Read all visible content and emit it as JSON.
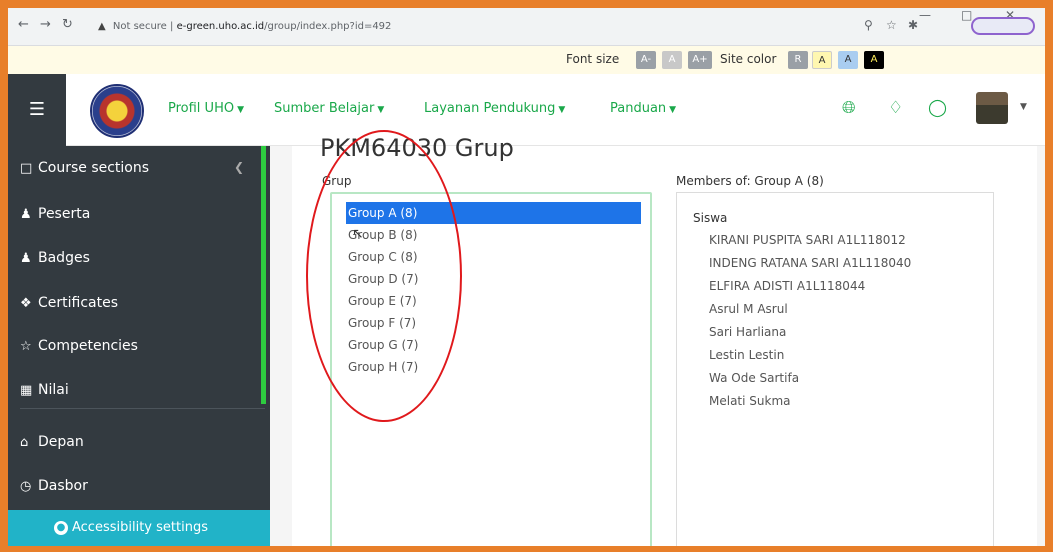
{
  "browser": {
    "security_label": "Not secure",
    "url_host": "e-green.uho.ac.id",
    "url_path": "/group/index.php?id=492"
  },
  "access_bar": {
    "font_size_label": "Font size",
    "font_buttons": [
      "A-",
      "A",
      "A+"
    ],
    "site_color_label": "Site color",
    "color_buttons": [
      "R",
      "A",
      "A",
      "A"
    ]
  },
  "navbar": {
    "menus": [
      {
        "label": "Profil UHO"
      },
      {
        "label": "Sumber Belajar"
      },
      {
        "label": "Layanan Pendukung"
      },
      {
        "label": "Panduan"
      }
    ]
  },
  "sidebar": {
    "items": [
      {
        "label": "Course sections"
      },
      {
        "label": "Peserta"
      },
      {
        "label": "Badges"
      },
      {
        "label": "Certificates"
      },
      {
        "label": "Competencies"
      },
      {
        "label": "Nilai"
      },
      {
        "label": "Depan"
      },
      {
        "label": "Dasbor"
      }
    ],
    "accessibility_label": "Accessibility settings"
  },
  "main": {
    "title": "PKM64030 Grup",
    "groups_label": "Grup",
    "groups": [
      "Group A (8)",
      "Group B (8)",
      "Group C (8)",
      "Group D (7)",
      "Group E (7)",
      "Group F (7)",
      "Group G (7)",
      "Group H (7)"
    ],
    "selected_group": "Group A (8)",
    "members_label": "Members of: Group A (8)",
    "members_role": "Siswa",
    "members": [
      "KIRANI PUSPITA SARI A1L118012",
      "INDENG RATANA SARI A1L118040",
      "ELFIRA ADISTI A1L118044",
      "Asrul M Asrul",
      "Sari Harliana",
      "Lestin Lestin",
      "Wa Ode Sartifa",
      "Melati Sukma"
    ]
  },
  "colors": {
    "accent_green": "#1aa84a",
    "sidebar_bg": "#333a40",
    "selected_blue": "#1e74e8",
    "annotation_red": "#e0191c",
    "border_orange": "#e87f2a"
  }
}
